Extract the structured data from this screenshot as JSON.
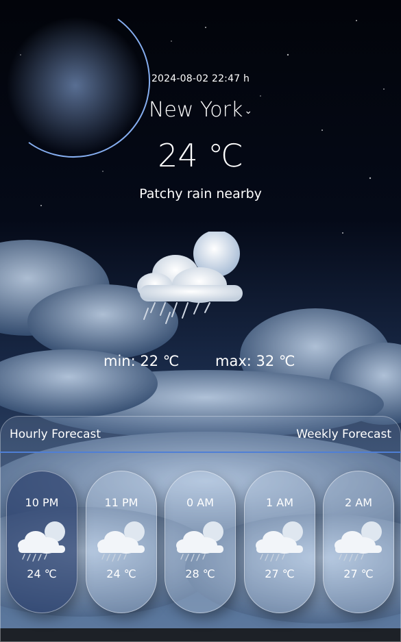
{
  "current": {
    "datetime": "2024-08-02 22:47 h",
    "city": "New York",
    "temperature": "24 ℃",
    "condition": "Patchy rain nearby",
    "min": "min: 22 ℃",
    "max": "max: 32 ℃",
    "icon": "moon-cloud-rain-icon"
  },
  "tabs": {
    "hourly": "Hourly Forecast",
    "weekly": "Weekly Forecast"
  },
  "hourly": [
    {
      "time": "10 PM",
      "temp": "24 ℃"
    },
    {
      "time": "11 PM",
      "temp": "24 ℃"
    },
    {
      "time": "0 AM",
      "temp": "28 ℃"
    },
    {
      "time": "1 AM",
      "temp": "27 ℃"
    },
    {
      "time": "2 AM",
      "temp": "27 ℃"
    }
  ],
  "colors": {
    "accent": "#4f7fd6",
    "active_card": "#2d416e"
  }
}
